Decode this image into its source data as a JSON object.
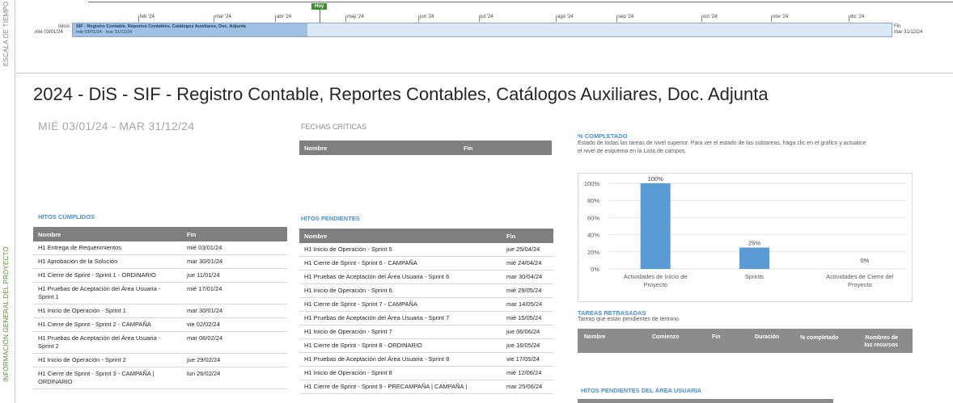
{
  "timeline": {
    "rail_label": "ESCALA DE TIEMPO",
    "today_label": "Hoy",
    "start_label": "Inicio",
    "start_date": "mié 03/01/24",
    "end_label": "Fin",
    "end_date": "mar 31/12/24",
    "months": [
      "feb '24",
      "mar '24",
      "abr '24",
      "may '24",
      "jun '24",
      "jul '24",
      "ago '24",
      "sep '24",
      "oct '24",
      "nov '24",
      "dic '24"
    ],
    "task_name": "SIF - Registro Contable, Reportes Contables, Catálogos Auxiliares, Doc. Adjunta",
    "task_dates": "mié 03/01/24 - mar 31/12/24"
  },
  "report": {
    "rail_label": "INFORMACIÓN GENERAL DEL PROYECTO",
    "title": "2024 - DiS - SIF - Registro Contable, Reportes Contables, Catálogos Auxiliares, Doc. Adjunta",
    "date_range": "MIÉ 03/01/24 -  MAR 31/12/24",
    "critical": {
      "heading": "FECHAS CRÍTICAS",
      "col_name": "Nombre",
      "col_end": "Fin"
    },
    "done": {
      "heading": "HITOS CUMPLIDOS",
      "col_name": "Nombre",
      "col_end": "Fin",
      "rows": [
        {
          "name": "H1 Entrega de Requerimientos",
          "end": "mié 03/01/24"
        },
        {
          "name": "H1 Aprobación de la Solución",
          "end": "mar 30/01/24"
        },
        {
          "name": "H1 Cierre de Sprint - Sprint 1 - ORDINARIO",
          "end": "jue 11/01/24"
        },
        {
          "name": "H1 Pruebas de Aceptación del Área Usuaria - Sprint 1",
          "end": "mié 17/01/24"
        },
        {
          "name": "H1 Inicio de Operación - Sprint 1",
          "end": "mar 30/01/24"
        },
        {
          "name": "H1 Cierre de Sprint - Sprint 2 - CAMPAÑA",
          "end": "vie 02/02/24"
        },
        {
          "name": "H1 Pruebas de Aceptación del Área Usuaria - Sprint 2",
          "end": "mar 06/02/24"
        },
        {
          "name": "H1 Inicio de Operación - Sprint 2",
          "end": "jue 29/02/24"
        },
        {
          "name": "H1 Cierre de Sprint - Sprint 3 - CAMPAÑA | ORDINARIO",
          "end": "lun 26/02/24"
        }
      ]
    },
    "pending": {
      "heading": "HITOS PENDIENTES",
      "col_name": "Nombre",
      "col_end": "Fin",
      "rows": [
        {
          "name": "H1 Inicio de Operación - Sprint 5",
          "end": "jue 25/04/24"
        },
        {
          "name": "H1 Cierre de Sprint - Sprint 6 - CAMPAÑA",
          "end": "mié 24/04/24"
        },
        {
          "name": "H1 Pruebas de Aceptación del Área Usuaria - Sprint 6",
          "end": "mar 30/04/24"
        },
        {
          "name": "H1 Inicio de Operación - Sprint 6",
          "end": "mié 29/05/24"
        },
        {
          "name": "H1 Cierre de Sprint - Sprint 7 - CAMPAÑA",
          "end": "mar 14/05/24"
        },
        {
          "name": "H1 Pruebas de Aceptación del Área Usuaria - Sprint 7",
          "end": "mié 15/05/24"
        },
        {
          "name": "H1 Inicio de Operación - Sprint 7",
          "end": "jue 06/06/24"
        },
        {
          "name": "H1 Cierre de Sprint - Sprint 8 - ORDINARIO",
          "end": "jue 16/05/24"
        },
        {
          "name": "H1 Pruebas de Aceptación del Área Usuaria - Sprint 8",
          "end": "vie 17/05/24"
        },
        {
          "name": "H1 Inicio de Operación - Sprint 8",
          "end": "mié 12/06/24"
        },
        {
          "name": "H1 Cierre de Sprint - Sprint 9 - PRECAMPAÑA | CAMPAÑA |",
          "end": "mar 25/06/24"
        }
      ]
    },
    "completed": {
      "heading": "% COMPLETADO",
      "description": "Estado de todas las tareas de nivel superior. Para ver el estado de las subtareas, haga clic en el gráfico y actualice el nivel de esquema en la Lista de campos."
    },
    "delayed": {
      "heading": "TAREAS RETRASADAS",
      "description": "Tareas que están pendientes de término.",
      "cols": [
        "Nombre",
        "Comienzo",
        "Fin",
        "Duración",
        "% completado",
        "Nombres de los recursos"
      ]
    },
    "user_pending": {
      "heading": "HITOS PENDIENTES DEL ÁREA USUARIA"
    }
  },
  "chart_data": {
    "type": "bar",
    "categories": [
      "Actividades de Inicio de Proyecto",
      "Sprints",
      "Actividades de Cierre del Proyecto"
    ],
    "values": [
      100,
      25,
      0
    ],
    "value_labels": [
      "100%",
      "25%",
      "0%"
    ],
    "ylim": [
      0,
      100
    ],
    "yticks": [
      "0%",
      "20%",
      "40%",
      "60%",
      "80%",
      "100%"
    ],
    "bar_color": "#5b9bd5",
    "grid": true
  }
}
